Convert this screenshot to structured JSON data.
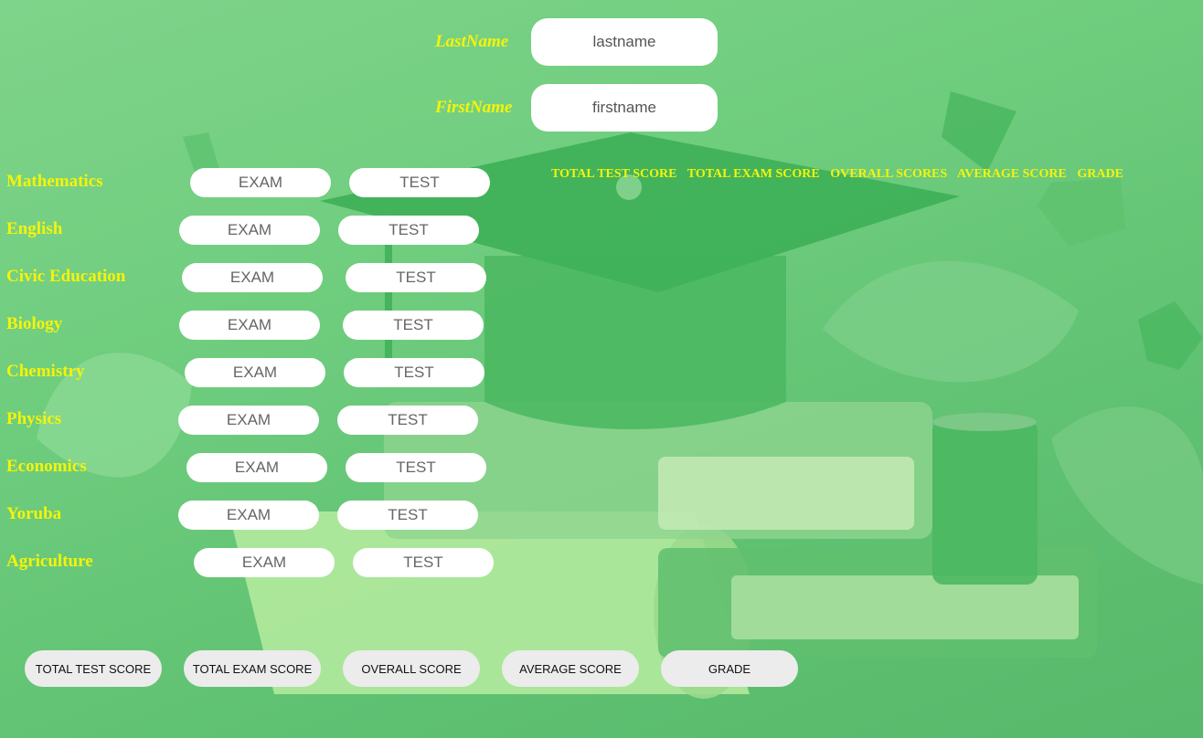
{
  "form": {
    "lastname": {
      "label": "LastName",
      "placeholder": "lastname"
    },
    "firstname": {
      "label": "FirstName",
      "placeholder": "firstname"
    }
  },
  "subjects": [
    {
      "name": "Mathematics",
      "exam_placeholder": "EXAM",
      "test_placeholder": "TEST"
    },
    {
      "name": "English",
      "exam_placeholder": "EXAM",
      "test_placeholder": "TEST"
    },
    {
      "name": "Civic Education",
      "exam_placeholder": "EXAM",
      "test_placeholder": "TEST"
    },
    {
      "name": "Biology",
      "exam_placeholder": "EXAM",
      "test_placeholder": "TEST"
    },
    {
      "name": "Chemistry",
      "exam_placeholder": "EXAM",
      "test_placeholder": "TEST"
    },
    {
      "name": "Physics",
      "exam_placeholder": "EXAM",
      "test_placeholder": "TEST"
    },
    {
      "name": "Economics",
      "exam_placeholder": "EXAM",
      "test_placeholder": "TEST"
    },
    {
      "name": "Yoruba",
      "exam_placeholder": "EXAM",
      "test_placeholder": "TEST"
    },
    {
      "name": "Agriculture",
      "exam_placeholder": "EXAM",
      "test_placeholder": "TEST"
    }
  ],
  "results_headers": [
    "TOTAL TEST SCORE",
    "TOTAL EXAM SCORE",
    "OVERALL SCORES",
    "AVERAGE SCORE",
    "GRADE"
  ],
  "buttons": {
    "total_test": "TOTAL TEST SCORE",
    "total_exam": "TOTAL EXAM SCORE",
    "overall": "OVERALL SCORE",
    "average": "AVERAGE SCORE",
    "grade": "GRADE"
  },
  "colors": {
    "label_yellow": "#f4f40a",
    "background_green": "#6fcd7e",
    "button_gray": "#ececec"
  }
}
